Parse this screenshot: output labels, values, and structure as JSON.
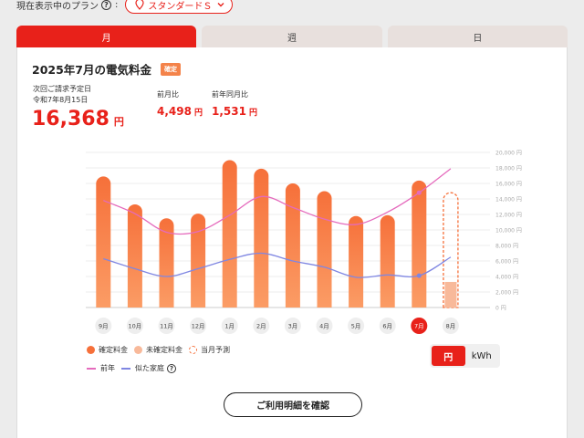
{
  "plan": {
    "label": "現在表示中のプラン",
    "help": "?",
    "selected": "スタンダードＳ"
  },
  "tabs": [
    {
      "label": "月",
      "active": true
    },
    {
      "label": "週",
      "active": false
    },
    {
      "label": "日",
      "active": false
    }
  ],
  "summary": {
    "title": "2025年7月の電気料金",
    "badge": "確定",
    "due_label": "次回ご請求予定日",
    "due_date": "令和7年8月15日",
    "amount": "16,368",
    "amount_unit": "円",
    "prev_month_label": "前月比",
    "prev_month_value": "4,498",
    "prev_year_label": "前年同月比",
    "prev_year_value": "1,531",
    "value_unit": "円"
  },
  "legend": {
    "confirmed": "確定料金",
    "unconfirmed": "未確定料金",
    "forecast": "当月予測",
    "last_year": "前年",
    "similar": "似た家庭",
    "help": "?"
  },
  "unit_toggle": {
    "yen": "円",
    "kwh": "kWh",
    "active": "yen"
  },
  "detail_button": "ご利用明細を確認",
  "colors": {
    "accent": "#e8211a",
    "bar_top": "#f6703a",
    "bar_bottom": "#fb9c65",
    "unconfirmed": "#f8b99a",
    "last_year": "#e56bbd",
    "similar": "#7f86e2"
  },
  "chart_data": {
    "type": "bar",
    "categories": [
      "9月",
      "10月",
      "11月",
      "12月",
      "1月",
      "2月",
      "3月",
      "4月",
      "5月",
      "6月",
      "7月",
      "8月"
    ],
    "selected": "7月",
    "ylim": [
      0,
      20000
    ],
    "yticks": [
      0,
      2000,
      4000,
      6000,
      8000,
      10000,
      12000,
      14000,
      16000,
      18000,
      20000
    ],
    "ytick_labels": [
      "0 円",
      "2,000 円",
      "4,000 円",
      "6,000 円",
      "8,000 円",
      "10,000 円",
      "12,000 円",
      "14,000 円",
      "16,000 円",
      "18,000 円",
      "20,000 円"
    ],
    "series": [
      {
        "name": "確定料金",
        "values": [
          16900,
          13300,
          11500,
          12100,
          19000,
          17900,
          16000,
          15000,
          11800,
          11900,
          16368,
          null
        ]
      },
      {
        "name": "未確定料金",
        "values": [
          null,
          null,
          null,
          null,
          null,
          null,
          null,
          null,
          null,
          null,
          null,
          3300
        ]
      },
      {
        "name": "当月予測",
        "values": [
          null,
          null,
          null,
          null,
          null,
          null,
          null,
          null,
          null,
          null,
          null,
          14800
        ]
      },
      {
        "name": "前年",
        "values": [
          13800,
          12100,
          9700,
          9800,
          11900,
          14300,
          12900,
          11400,
          10700,
          12300,
          14800,
          17900
        ]
      },
      {
        "name": "似た家庭",
        "values": [
          6300,
          5000,
          4000,
          5000,
          6200,
          7000,
          6000,
          5200,
          3900,
          4200,
          4100,
          6500
        ]
      }
    ]
  }
}
